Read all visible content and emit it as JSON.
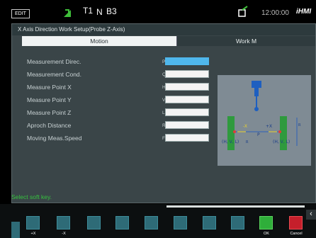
{
  "status": {
    "edit_label": "EDIT",
    "t_label": "T1",
    "n_label": "N",
    "b_label": "B3",
    "time": "12:00:00",
    "logo": "iHMI",
    "signal_icon": "signal-arrow-icon",
    "transfer_icon": "transfer-icon"
  },
  "window": {
    "title": "X Axis Direction Work Setup(Probe Z-Axis)",
    "tabs": [
      "Motion",
      "Work M"
    ],
    "active_tab": "Motion"
  },
  "form": {
    "rows": [
      {
        "label": "Measurement Direc.",
        "key": "P",
        "value": "",
        "active": true
      },
      {
        "label": "Measurement Cond.",
        "key": "Q",
        "value": ""
      },
      {
        "label": "Measure Point X",
        "key": "H",
        "value": ""
      },
      {
        "label": "Measure Point Y",
        "key": "V",
        "value": ""
      },
      {
        "label": "Measure Point Z",
        "key": "L",
        "value": ""
      },
      {
        "label": "Aproch Distance",
        "key": "R",
        "value": ""
      },
      {
        "label": "Moving Meas.Speed",
        "key": "F",
        "value": ""
      }
    ]
  },
  "diagram": {
    "label_left": "(H, V, L)",
    "label_right": "(H, V, L)",
    "label_p": "P",
    "label_plus_x": "+X",
    "label_minus_x": "-X",
    "label_r": "R",
    "label_r2": "R"
  },
  "message": "Select soft key.",
  "softkeys": [
    {
      "label": "+X"
    },
    {
      "label": "-X"
    },
    {
      "label": ""
    },
    {
      "label": ""
    },
    {
      "label": ""
    },
    {
      "label": ""
    },
    {
      "label": ""
    },
    {
      "label": ""
    },
    {
      "label": ""
    },
    {
      "label": "OK"
    },
    {
      "label": "Cancel"
    }
  ],
  "colors": {
    "accent_blue": "#4fb7ec",
    "ok_green": "#2fae3a",
    "cancel_red": "#c51f2b",
    "message_green": "#35c23e"
  }
}
